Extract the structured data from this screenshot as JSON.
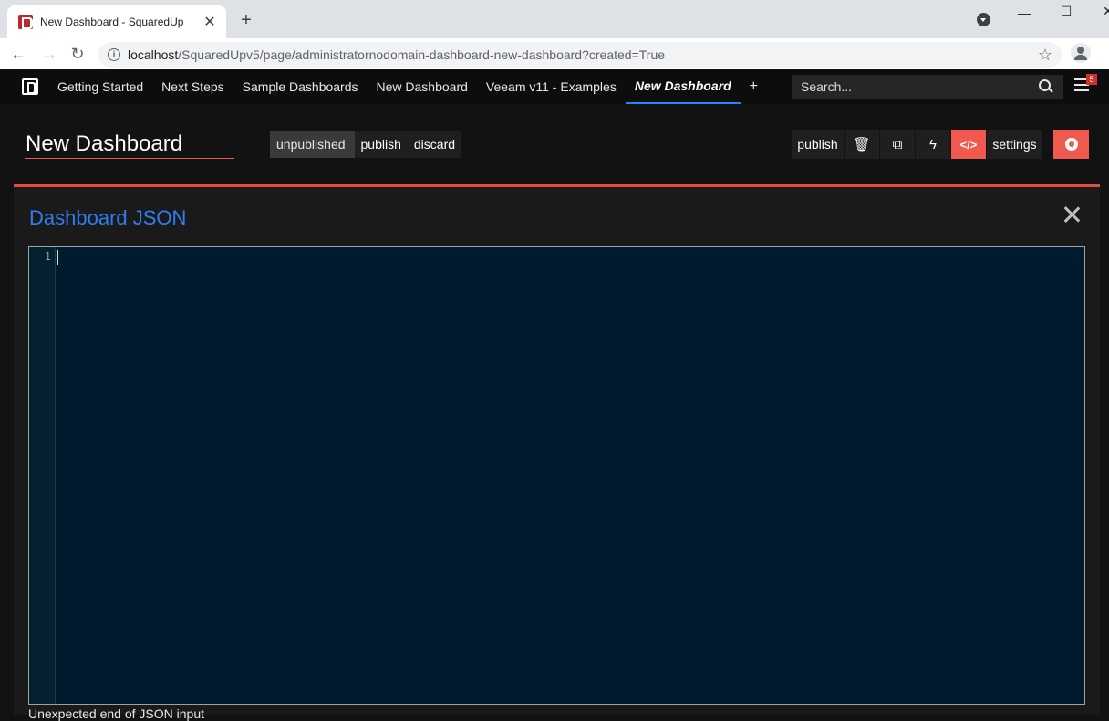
{
  "browser": {
    "tab_title": "New Dashboard - SquaredUp",
    "tab_close": "✕",
    "new_tab": "+",
    "url_host": "localhost",
    "url_path": "/SquaredUpv5/page/administratornodomain-dashboard-new-dashboard?created=True",
    "window_min": "—",
    "window_max": "☐",
    "window_close": "✕"
  },
  "nav": {
    "links": [
      "Getting Started",
      "Next Steps",
      "Sample Dashboards",
      "New Dashboard",
      "Veeam v11 - Examples"
    ],
    "active_link": "New Dashboard",
    "add": "+",
    "search_placeholder": "Search...",
    "notification_count": "5"
  },
  "dashboard": {
    "title": "New Dashboard",
    "state": "unpublished",
    "publish_label": "publish",
    "discard_label": "discard",
    "toolbar": {
      "publish": "publish",
      "code": "</>",
      "settings": "settings",
      "icons": [
        "trash-icon",
        "copy-icon",
        "lightning-icon",
        "code-icon",
        "gear-icon"
      ]
    },
    "accent_color": "#f05a4e"
  },
  "panel": {
    "title": "Dashboard JSON",
    "line_number": "1",
    "error": "Unexpected end of JSON input"
  }
}
